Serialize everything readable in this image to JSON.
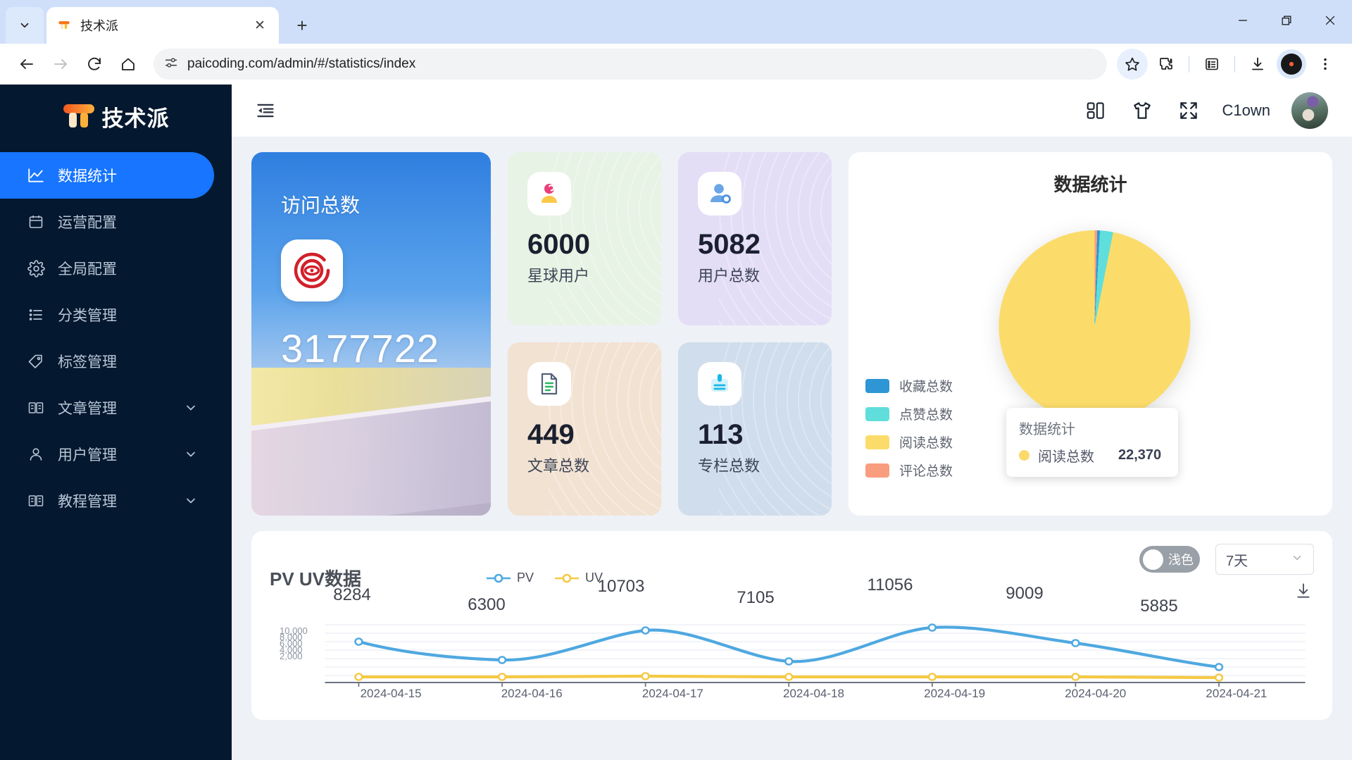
{
  "browser": {
    "tab_title": "技术派",
    "url": "paicoding.com/admin/#/statistics/index",
    "new_tab_label": "+",
    "close_label": "✕",
    "minimize_label": "—",
    "maximize_label": "❐",
    "window_close_label": "✕"
  },
  "sidebar": {
    "brand": "技术派",
    "items": [
      {
        "label": "数据统计",
        "icon": "chart-line-icon",
        "active": true,
        "expandable": false
      },
      {
        "label": "运营配置",
        "icon": "calendar-icon",
        "active": false,
        "expandable": false
      },
      {
        "label": "全局配置",
        "icon": "gear-icon",
        "active": false,
        "expandable": false
      },
      {
        "label": "分类管理",
        "icon": "list-icon",
        "active": false,
        "expandable": false
      },
      {
        "label": "标签管理",
        "icon": "tag-icon",
        "active": false,
        "expandable": false
      },
      {
        "label": "文章管理",
        "icon": "book-icon",
        "active": false,
        "expandable": true
      },
      {
        "label": "用户管理",
        "icon": "user-icon",
        "active": false,
        "expandable": true
      },
      {
        "label": "教程管理",
        "icon": "book-icon",
        "active": false,
        "expandable": true
      }
    ]
  },
  "topbar": {
    "collapse_icon": "collapse-sidebar-icon",
    "icons": [
      "layout-grid-icon",
      "tshirt-theme-icon",
      "fullscreen-icon"
    ],
    "username": "C1own"
  },
  "visit_card": {
    "title": "访问总数",
    "value": "3177722",
    "icon": "eye-target-icon"
  },
  "stats": [
    {
      "value": "6000",
      "label": "星球用户",
      "icon": "planet-user-icon",
      "bg": "#e7f3e4",
      "accent": "#e8467c"
    },
    {
      "value": "5082",
      "label": "用户总数",
      "icon": "user-add-icon",
      "bg": "#e4ddf6",
      "accent": "#6aa5e8"
    },
    {
      "value": "449",
      "label": "文章总数",
      "icon": "document-icon",
      "bg": "#f2e2d2",
      "accent": "#34b96a"
    },
    {
      "value": "113",
      "label": "专栏总数",
      "icon": "column-card-icon",
      "bg": "#cfddec",
      "accent": "#22b7ea"
    }
  ],
  "pie_panel": {
    "title": "数据统计",
    "tooltip": {
      "title": "数据统计",
      "name": "阅读总数",
      "value": "22,370",
      "color": "#fbd96b"
    }
  },
  "chart_data": [
    {
      "type": "pie",
      "title": "数据统计",
      "labels": [
        "收藏总数",
        "点赞总数",
        "阅读总数",
        "评论总数"
      ],
      "values": [
        105,
        520,
        22370,
        140
      ],
      "colors": [
        "#2e96d4",
        "#5fdedb",
        "#fbdc6b",
        "#f99d7f"
      ],
      "legend_position": "bottom-left",
      "highlighted": "阅读总数",
      "highlighted_value": "22,370"
    },
    {
      "type": "line",
      "title": "PV UV数据",
      "x": [
        "2024-04-15",
        "2024-04-16",
        "2024-04-17",
        "2024-04-18",
        "2024-04-19",
        "2024-04-20",
        "2024-04-21"
      ],
      "series": [
        {
          "name": "PV",
          "color": "#4fa8e0",
          "values": [
            8284,
            6300,
            10703,
            7105,
            11056,
            9009,
            5885
          ]
        },
        {
          "name": "UV",
          "color": "#f5c944",
          "values": [
            300,
            290,
            310,
            295,
            305,
            300,
            280
          ]
        }
      ],
      "point_labels": [
        "8284",
        "6300",
        "10703",
        "7105",
        "11056",
        "9009",
        "5885"
      ],
      "ytick_labels": [
        "10,000",
        "8,000",
        "6,000",
        "4,000",
        "2,000"
      ],
      "ylim": [
        0,
        12000
      ],
      "grid": true,
      "legend_position": "top-center",
      "xlabel": "",
      "ylabel": ""
    }
  ],
  "chart_controls": {
    "theme_toggle_label": "浅色",
    "range_value": "7天",
    "download_icon": "download-icon"
  }
}
